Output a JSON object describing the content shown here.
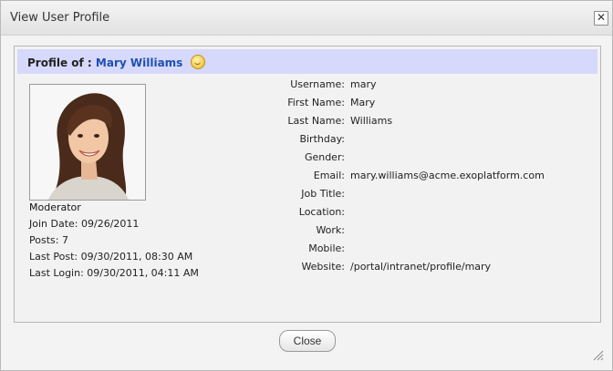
{
  "dialog": {
    "title": "View User Profile",
    "close_icon": "close-icon",
    "close_button_label": "Close"
  },
  "profile": {
    "header_prefix": "Profile of :",
    "display_name": "Mary Williams",
    "status_icon": "smiley-status-icon",
    "role": "Moderator",
    "join_date": "Join Date: 09/26/2011",
    "posts": "Posts: 7",
    "last_post": "Last Post: 09/30/2011, 08:30 AM",
    "last_login": "Last Login: 09/30/2011, 04:11 AM"
  },
  "fields": [
    {
      "label": "Username:",
      "value": "mary"
    },
    {
      "label": "First Name:",
      "value": "Mary"
    },
    {
      "label": "Last Name:",
      "value": "Williams"
    },
    {
      "label": "Birthday:",
      "value": ""
    },
    {
      "label": "Gender:",
      "value": ""
    },
    {
      "label": "Email:",
      "value": "mary.williams@acme.exoplatform.com"
    },
    {
      "label": "Job Title:",
      "value": ""
    },
    {
      "label": "Location:",
      "value": ""
    },
    {
      "label": "Work:",
      "value": ""
    },
    {
      "label": "Mobile:",
      "value": ""
    },
    {
      "label": "Website:",
      "value": "/portal/intranet/profile/mary"
    }
  ]
}
